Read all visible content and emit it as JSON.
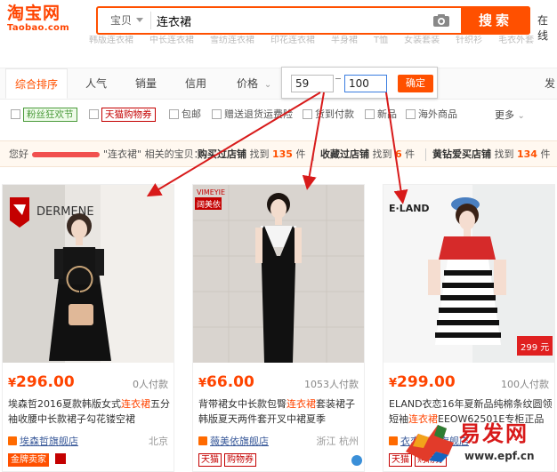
{
  "header": {
    "logo_cn": "淘宝网",
    "logo_en": "Taobao.com",
    "search_type": "宝贝",
    "search_value": "连衣裙",
    "search_button": "搜索",
    "right_text": "在线"
  },
  "hotwords": [
    "韩版连衣裙",
    "中长连衣裙",
    "雪纺连衣裙",
    "印花连衣裙",
    "半身裙",
    "T恤",
    "女装套装",
    "针织衫",
    "毛衣外套"
  ],
  "sortbar": {
    "sorts": [
      "综合排序",
      "人气",
      "销量",
      "信用",
      "价格"
    ],
    "price_min": "59",
    "price_max": "100",
    "confirm": "确定",
    "right_text": "发"
  },
  "filters": {
    "items": [
      "粉丝狂欢节",
      "天猫购物券",
      "包邮",
      "赠送退货运费险",
      "货到付款",
      "新品",
      "海外商品"
    ],
    "more": "更多"
  },
  "stats": {
    "prefix": "您好",
    "keyword_text": "\"连衣裙\" 相关的宝贝：",
    "s1_label": "购买过店铺",
    "s1_found": "找到",
    "s1_num": "135",
    "s1_unit": "件",
    "s2_label": "收藏过店铺",
    "s2_found": "找到",
    "s2_num": "6",
    "s2_unit": "件",
    "s3_label": "黄钻爱买店铺",
    "s3_found": "找到",
    "s3_num": "134",
    "s3_unit": "件"
  },
  "products": [
    {
      "brand": "",
      "price": "296.00",
      "payers": "0人付款",
      "title_pre": "埃森哲2016夏款韩版女式",
      "title_hl": "连衣裙",
      "title_post": "五分袖收腰中长款裙子勾花镂空裙",
      "shop": "埃森哲旗舰店",
      "location": "北京",
      "badge1": "金牌卖家"
    },
    {
      "brand": "VIMEYIE 阔美依",
      "price": "66.00",
      "payers": "1053人付款",
      "title_pre": "背带裙女中长款包臀",
      "title_hl": "连衣裙",
      "title_post": "套装裙子韩版夏天两件套开叉中裙夏季",
      "shop": "薇美依旗舰店",
      "location": "浙江 杭州",
      "badge1": "天猫",
      "badge2": "购物券"
    },
    {
      "brand": "E·LAND",
      "price": "299.00",
      "payers": "100人付款",
      "title_pre": "ELAND衣恋16年夏新品纯棉条纹圆领短袖",
      "title_hl": "连衣裙",
      "title_post": "EEOW62501E专柜正品",
      "shop": "衣恋官方旗舰店",
      "location": "",
      "badge1": "天猫",
      "badge2": "购物券",
      "image_tag": "299 元"
    }
  ],
  "watermark": {
    "title": "易发网",
    "url": "www.epf.cn"
  }
}
